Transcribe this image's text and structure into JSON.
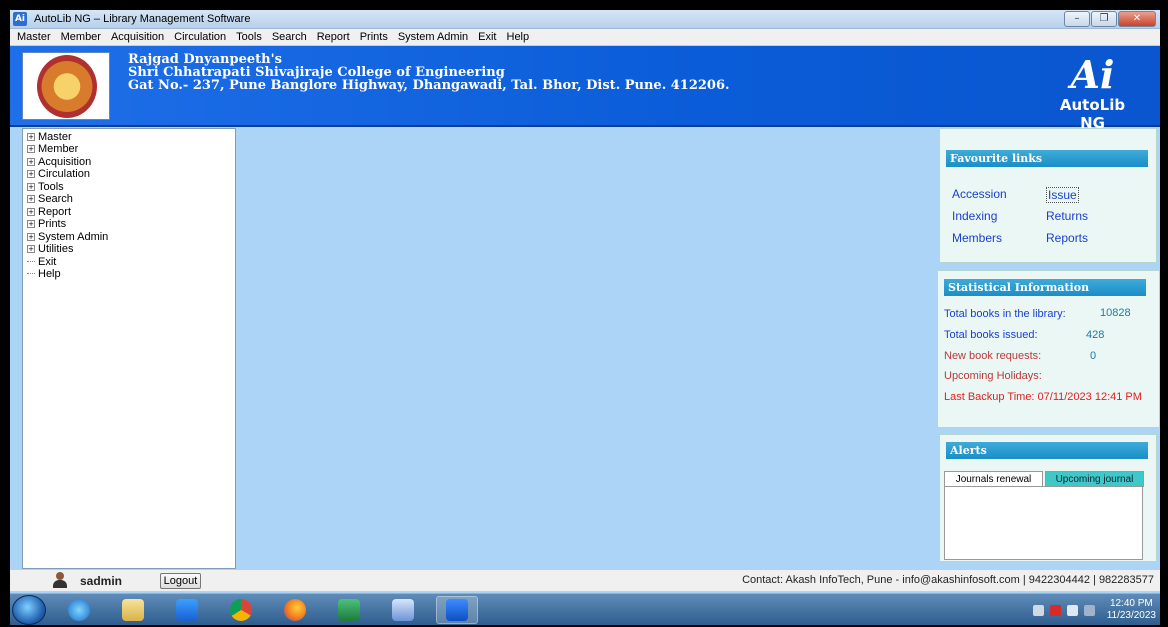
{
  "window": {
    "title": "AutoLib NG – Library Management Software"
  },
  "menu": [
    "Master",
    "Member",
    "Acquisition",
    "Circulation",
    "Tools",
    "Search",
    "Report",
    "Prints",
    "System Admin",
    "Exit",
    "Help"
  ],
  "banner": {
    "line1": "Rajgad Dnyanpeeth's",
    "line2": "Shri Chhatrapati Shivajiraje College of Engineering",
    "line3": "Gat No.- 237, Pune Banglore Highway, Dhangawadi, Tal. Bhor, Dist. Pune. 412206.",
    "product_mark": "Ai",
    "product_name": "AutoLib NG"
  },
  "tree": {
    "expandable": [
      "Master",
      "Member",
      "Acquisition",
      "Circulation",
      "Tools",
      "Search",
      "Report",
      "Prints",
      "System Admin",
      "Utilities"
    ],
    "leaves": [
      "Exit",
      "Help"
    ]
  },
  "favourites": {
    "title": "Favourite links",
    "links": [
      "Accession",
      "Issue",
      "Indexing",
      "Returns",
      "Members",
      "Reports"
    ]
  },
  "stats": {
    "title": "Statistical Information",
    "total_books_label": "Total books in the library:",
    "total_books_value": "10828",
    "issued_label": "Total books issued:",
    "issued_value": "428",
    "requests_label": "New book requests:",
    "requests_value": "0",
    "holidays_label": "Upcoming Holidays:",
    "backup": "Last Backup Time: 07/11/2023 12:41 PM"
  },
  "alerts": {
    "title": "Alerts",
    "tabs": [
      "Journals renewal",
      "Upcoming journal"
    ]
  },
  "status": {
    "user": "sadmin",
    "logout": "Logout",
    "contact": "Contact: Akash InfoTech, Pune - info@akashinfosoft.com | 9422304442 | 982283577"
  },
  "taskbar": {
    "time": "12:40 PM",
    "date": "11/23/2023"
  },
  "colors": {
    "workspace": "#acd4f7",
    "banner": "#0b5cd8",
    "link": "#1a3fd0",
    "alert_red": "#e02020"
  }
}
